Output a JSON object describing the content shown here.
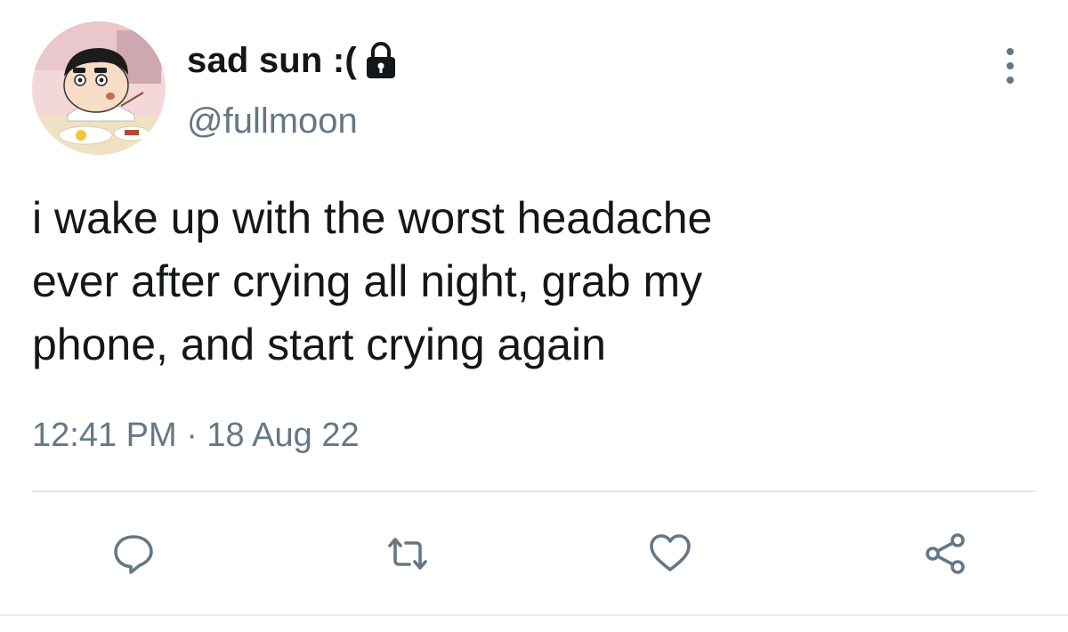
{
  "user": {
    "display_name": "sad sun :(",
    "handle": "@fullmoon",
    "avatar_icon": "cartoon-boy-avatar",
    "protected_icon": "lock-icon"
  },
  "tweet": {
    "lines": [
      "i wake up with the worst headache",
      "ever after crying all night, grab my",
      "phone, and start crying again"
    ],
    "timestamp": "12:41 PM · 18 Aug 22"
  },
  "actions": {
    "reply_icon": "reply-icon",
    "retweet_icon": "retweet-icon",
    "like_icon": "heart-icon",
    "share_icon": "share-icon",
    "more_icon": "more-vertical-icon"
  },
  "colors": {
    "primary_text": "#14171a",
    "secondary_text": "#657786",
    "action_icon": "#657786",
    "divider": "#e1e8ed"
  }
}
